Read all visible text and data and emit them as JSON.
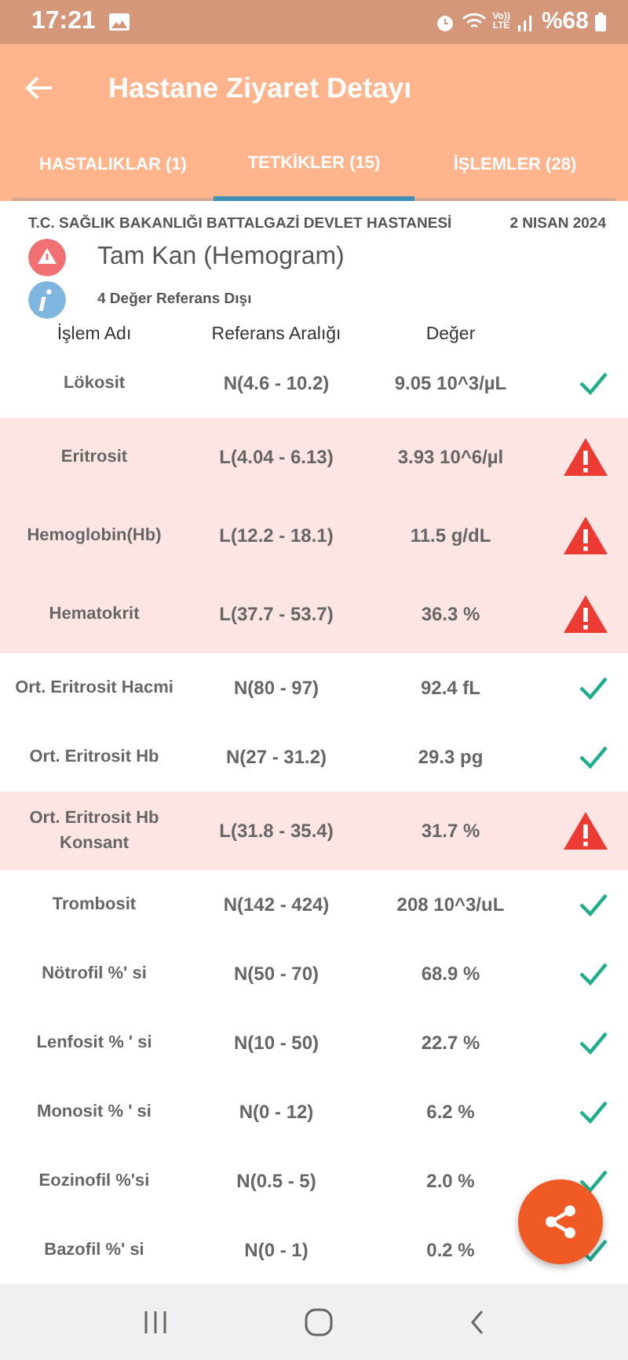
{
  "status_bar": {
    "time": "17:21",
    "volte": "Vo))\nLTE",
    "battery": "%68"
  },
  "app_bar": {
    "title": "Hastane Ziyaret Detayı"
  },
  "tabs": [
    {
      "label": "HASTALIKLAR (1)",
      "selected": false
    },
    {
      "label": "TETKİKLER (15)",
      "selected": true
    },
    {
      "label": "İŞLEMLER (28)",
      "selected": false
    }
  ],
  "report": {
    "hospital": "T.C. SAĞLIK BAKANLIĞI BATTALGAZİ DEVLET HASTANESİ",
    "date": "2 NISAN 2024",
    "test_name": "Tam Kan (Hemogram)",
    "summary": "4 Değer Referans Dışı"
  },
  "table": {
    "columns": [
      "İşlem Adı",
      "Referans Aralığı",
      "Değer"
    ],
    "rows": [
      {
        "name": "Lökosit",
        "range": "N(4.6 - 10.2)",
        "value": "9.05 10^3/µL",
        "abnormal": false
      },
      {
        "name": "Eritrosit",
        "range": "L(4.04 - 6.13)",
        "value": "3.93 10^6/µl",
        "abnormal": true
      },
      {
        "name": "Hemoglobin(Hb)",
        "range": "L(12.2 - 18.1)",
        "value": "11.5 g/dL",
        "abnormal": true
      },
      {
        "name": "Hematokrit",
        "range": "L(37.7 - 53.7)",
        "value": "36.3 %",
        "abnormal": true
      },
      {
        "name": "Ort. Eritrosit Hacmi",
        "range": "N(80 - 97)",
        "value": "92.4 fL",
        "abnormal": false
      },
      {
        "name": "Ort. Eritrosit Hb",
        "range": "N(27 - 31.2)",
        "value": "29.3 pg",
        "abnormal": false
      },
      {
        "name": "Ort. Eritrosit Hb Konsant",
        "range": "L(31.8 - 35.4)",
        "value": "31.7 %",
        "abnormal": true
      },
      {
        "name": "Trombosit",
        "range": "N(142 - 424)",
        "value": "208 10^3/uL",
        "abnormal": false
      },
      {
        "name": "Nötrofil %' si",
        "range": "N(50 - 70)",
        "value": "68.9 %",
        "abnormal": false
      },
      {
        "name": "Lenfosit % ' si",
        "range": "N(10 - 50)",
        "value": "22.7 %",
        "abnormal": false
      },
      {
        "name": "Monosit % ' si",
        "range": "N(0 - 12)",
        "value": "6.2 %",
        "abnormal": false
      },
      {
        "name": "Eozinofil %'si",
        "range": "N(0.5 - 5)",
        "value": "2.0 %",
        "abnormal": false
      },
      {
        "name": "Bazofil %' si",
        "range": "N(0 - 1)",
        "value": "0.2 %",
        "abnormal": false
      }
    ]
  }
}
